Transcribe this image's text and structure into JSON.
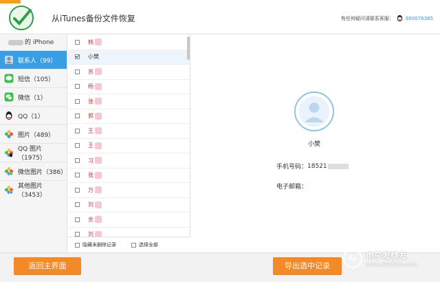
{
  "header": {
    "title": "从iTunes备份文件恢复",
    "support_text": "有任何疑问请联系客服：",
    "support_number": "800076365"
  },
  "sidebar": {
    "device": "的 iPhone",
    "items": [
      {
        "label": "联系人（99）",
        "icon": "contacts-icon",
        "color": "#8a9ab0"
      },
      {
        "label": "短信（105）",
        "icon": "sms-icon",
        "color": "#3cc24a"
      },
      {
        "label": "微信（1）",
        "icon": "wechat-icon",
        "color": "#3cc24a"
      },
      {
        "label": "QQ（1）",
        "icon": "qq-icon",
        "color": "#222222"
      },
      {
        "label": "图片（489）",
        "icon": "photos-icon",
        "color": "#e9a23b"
      },
      {
        "label": "QQ 图片（1975）",
        "icon": "qq-photos-icon",
        "color": "#e9a23b"
      },
      {
        "label": "微信图片（386）",
        "icon": "wechat-photos-icon",
        "color": "#e9a23b"
      },
      {
        "label": "其他图片（3453）",
        "icon": "other-photos-icon",
        "color": "#e9a23b"
      }
    ]
  },
  "contacts": [
    {
      "name": "韩",
      "checked": false
    },
    {
      "name": "小樊",
      "checked": true
    },
    {
      "name": "苏",
      "checked": false
    },
    {
      "name": "杨",
      "checked": false
    },
    {
      "name": "张",
      "checked": false
    },
    {
      "name": "郭",
      "checked": false
    },
    {
      "name": "王",
      "checked": false
    },
    {
      "name": "王",
      "checked": false
    },
    {
      "name": "习",
      "checked": false
    },
    {
      "name": "张",
      "checked": false
    },
    {
      "name": "万",
      "checked": false
    },
    {
      "name": "刘",
      "checked": false
    },
    {
      "name": "余",
      "checked": false
    },
    {
      "name": "刘",
      "checked": false
    }
  ],
  "list_footer": {
    "hide_undeleted": "隐藏未删除记录",
    "select_all": "选择全部"
  },
  "detail": {
    "name": "小樊",
    "phone_label": "手机号码：",
    "phone_value": "18521",
    "email_label": "电子邮箱："
  },
  "buttons": {
    "back": "返回主界面",
    "export": "导出选中记录"
  },
  "watermark": {
    "cn": "电子发烧友",
    "en": "www.elecfans.com"
  },
  "colors": {
    "accent": "#3a9ee4",
    "button": "#f38a2a",
    "name_red": "#cc3333"
  }
}
